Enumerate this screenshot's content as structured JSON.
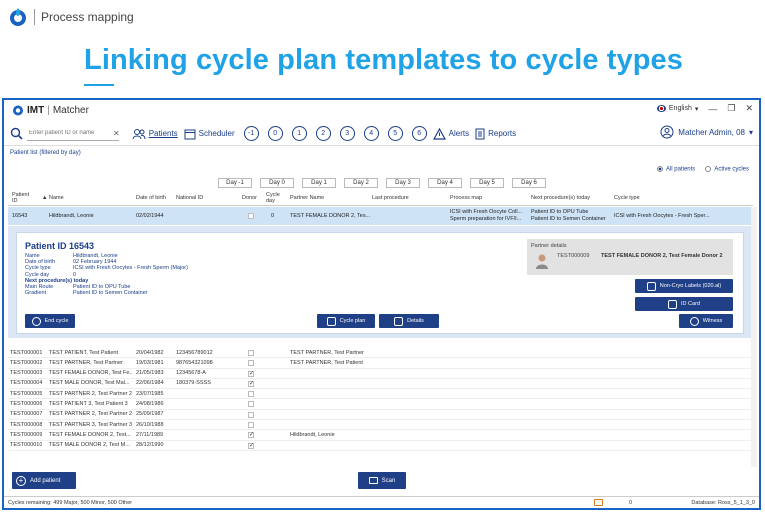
{
  "slide": {
    "header_text": "Process mapping",
    "title": "Linking cycle plan templates to cycle types"
  },
  "app": {
    "logo_imt": "IMT",
    "logo_sep": "|",
    "logo_name": "Matcher",
    "language": "English",
    "search_placeholder": "Enter patient ID or name",
    "toolbar": {
      "patients": "Patients",
      "scheduler": "Scheduler",
      "numbers": [
        "-1",
        "0",
        "1",
        "2",
        "3",
        "4",
        "5",
        "6"
      ],
      "alerts": "Alerts",
      "reports": "Reports"
    },
    "user": "Matcher Admin, 08",
    "list_label": "Patient list (filtered by day)",
    "radio_all": "All patients",
    "radio_active": "Active cycles",
    "days": [
      "Day -1",
      "Day 0",
      "Day 1",
      "Day 2",
      "Day 3",
      "Day 4",
      "Day 5",
      "Day 6"
    ],
    "columns": {
      "patient_id": "Patient ID",
      "name": "Name",
      "dob": "Date of birth",
      "national_id": "National ID",
      "donor": "Donor",
      "cycle_day": "Cycle day",
      "partner_name": "Partner Name",
      "last_procedure": "Last procedure",
      "process_map": "Process map",
      "next_procedure": "Next procedure(s) today",
      "cycle_type": "Cycle type"
    },
    "selected_row": {
      "id": "16543",
      "name": "Hildbrandt, Leonie",
      "dob": "02/02/1944",
      "cycle_day": "0",
      "partner": "TEST FEMALE DONOR 2, Tes...",
      "process_map_1": "ICSI with Fresh Oocyte Coll...",
      "process_map_2": "Sperm preparation for IVF/I...",
      "next_1": "Patient ID to OPU Tube",
      "next_2": "Patient ID to Semen Container",
      "cycle_type": "ICSI with Fresh Oocytes - Fresh Sper..."
    },
    "detail": {
      "title": "Patient ID 16543",
      "rows": [
        {
          "k": "Name",
          "v": "Hildbrandt, Leonie"
        },
        {
          "k": "Date of birth",
          "v": "02 February 1944"
        },
        {
          "k": "Cycle type",
          "v": "ICSI with Fresh Oocytes - Fresh Sperm (Major)"
        },
        {
          "k": "Cycle day",
          "v": "0"
        }
      ],
      "next_label": "Next procedure(s) today",
      "main_route_k": "Main Route",
      "main_route_v": "Patient ID to OPU Tube",
      "gradient_k": "Gradient",
      "gradient_v": "Patient ID to Semen Container",
      "partner_title": "Partner details",
      "partner_id": "TEST000009",
      "partner_name": "TEST FEMALE DONOR 2, Test Female Donor 2",
      "btn_labels": "Non-Cryo Labels (020.al)",
      "btn_idcard": "ID Card",
      "btn_witness": "Witness",
      "btn_end_cycle": "End cycle",
      "btn_cycle_plan": "Cycle plan",
      "btn_details": "Details"
    },
    "rows": [
      {
        "id": "TEST000001",
        "name": "TEST PATIENT, Test Patient",
        "dob": "20/04/1982",
        "nid": "123456789012",
        "donor": false,
        "partner": "TEST PARTNER, Test Partner"
      },
      {
        "id": "TEST000002",
        "name": "TEST PARTNER, Test Partner",
        "dob": "19/03/1981",
        "nid": "987654321098",
        "donor": false,
        "partner": "TEST PARTNER, Test Patient"
      },
      {
        "id": "TEST000003",
        "name": "TEST FEMALE DONOR, Test Fe...",
        "dob": "21/05/1983",
        "nid": "12345678-A",
        "donor": true,
        "partner": ""
      },
      {
        "id": "TEST000004",
        "name": "TEST MALE DONOR, Test Mal...",
        "dob": "22/06/1984",
        "nid": "180379-SSSS",
        "donor": true,
        "partner": ""
      },
      {
        "id": "TEST000005",
        "name": "TEST PARTNER 2, Test Partner 2",
        "dob": "23/07/1985",
        "nid": "",
        "donor": false,
        "partner": ""
      },
      {
        "id": "TEST000006",
        "name": "TEST PATIENT 3, Test Patient 3",
        "dob": "24/08/1986",
        "nid": "",
        "donor": false,
        "partner": ""
      },
      {
        "id": "TEST000007",
        "name": "TEST PARTNER 2, Test Partner 2",
        "dob": "25/09/1987",
        "nid": "",
        "donor": false,
        "partner": ""
      },
      {
        "id": "TEST000008",
        "name": "TEST PARTNER 3, Test Partner 3",
        "dob": "26/10/1988",
        "nid": "",
        "donor": false,
        "partner": ""
      },
      {
        "id": "TEST000009",
        "name": "TEST FEMALE DONOR 2, Test...",
        "dob": "27/11/1989",
        "nid": "",
        "donor": true,
        "partner": "Hildbrandt, Leonie"
      },
      {
        "id": "TEST000010",
        "name": "TEST MALE DONOR 2, Test M...",
        "dob": "28/12/1990",
        "nid": "",
        "donor": true,
        "partner": ""
      }
    ],
    "add_patient": "Add patient",
    "scan": "Scan",
    "status_left": "Cycles remaining: 499 Major, 500 Minor, 500 Other",
    "status_mid": "0",
    "status_right": "Database: Ross_5_1_3_0"
  }
}
